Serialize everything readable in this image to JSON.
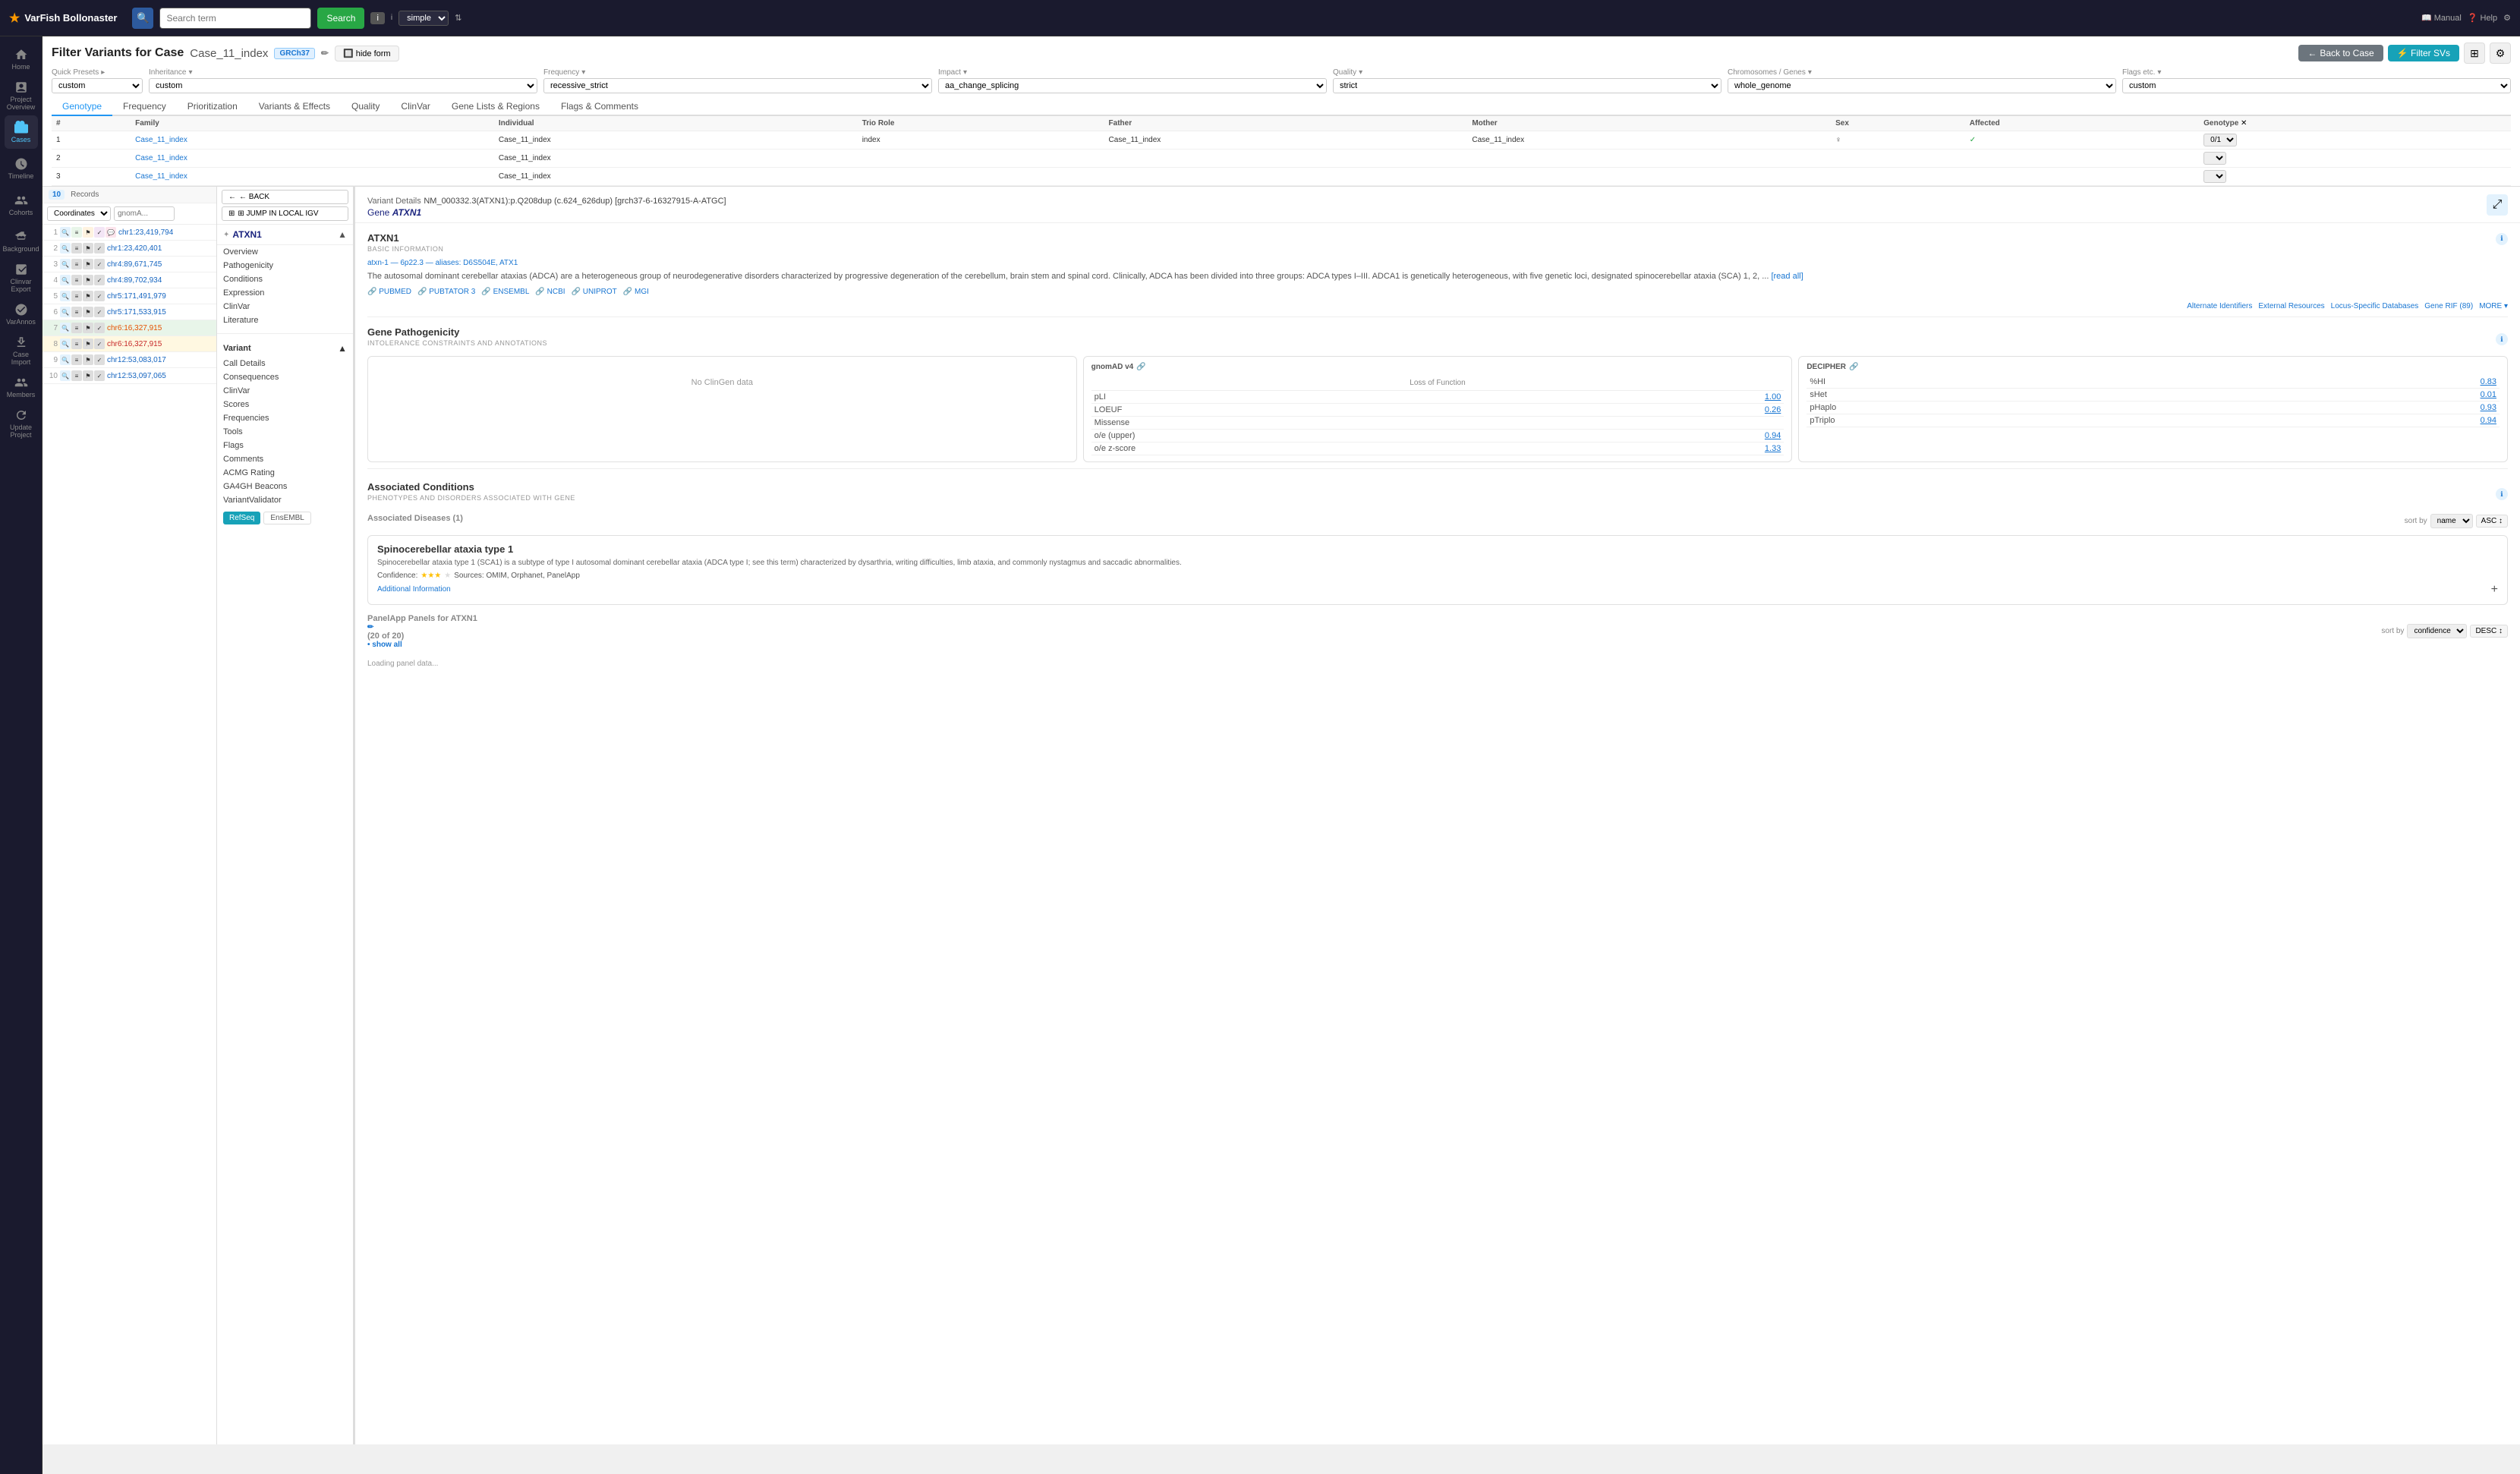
{
  "app": {
    "name": "VarFish",
    "name_colored": "Bollonaster",
    "logo": "★"
  },
  "navbar": {
    "search_placeholder": "Search term",
    "search_btn": "Search",
    "toggle_label": "i",
    "mode_label": "simple",
    "manual_label": "Manual",
    "help_label": "Help"
  },
  "header": {
    "title": "Filter Variants for Case",
    "case_name": "Case_11_index",
    "grch_badge": "GRCh37",
    "hide_form": "hide form",
    "back_to_case": "Back to Case",
    "filter_svs": "Filter SVs"
  },
  "filter_row": {
    "quick_presets_label": "Quick Presets",
    "quick_presets_arrow": "▸",
    "inheritance_label": "Inheritance",
    "inheritance_arrow": "▾",
    "inheritance_value": "custom",
    "frequency_label": "Frequency",
    "frequency_arrow": "▾",
    "frequency_value": "recessive_strict",
    "impact_label": "Impact",
    "impact_arrow": "▾",
    "impact_value": "aa_change_splicing",
    "quality_label": "Quality",
    "quality_arrow": "▾",
    "quality_value": "strict",
    "chromosomes_label": "Chromosomes / Genes",
    "chromosomes_arrow": "▾",
    "chromosomes_value": "whole_genome",
    "flags_label": "Flags etc.",
    "flags_arrow": "▾",
    "flags_value": "custom"
  },
  "sub_tabs": [
    {
      "id": "genotype",
      "label": "Genotype"
    },
    {
      "id": "frequency",
      "label": "Frequency"
    },
    {
      "id": "prioritization",
      "label": "Prioritization"
    },
    {
      "id": "variants_effects",
      "label": "Variants & Effects"
    },
    {
      "id": "quality",
      "label": "Quality"
    },
    {
      "id": "clinvar",
      "label": "ClinVar"
    },
    {
      "id": "gene_lists",
      "label": "Gene Lists & Regions"
    },
    {
      "id": "flags_comments",
      "label": "Flags & Comments"
    }
  ],
  "active_tab": "genotype",
  "genotype_table": {
    "columns": [
      "#",
      "Family",
      "Individual",
      "Trio Role",
      "Father",
      "Mother",
      "Sex",
      "Affected",
      "Genotype"
    ],
    "rows": [
      {
        "num": "1",
        "family": "Case_11_index",
        "individual": "Case_11_index",
        "trio_role": "index",
        "father": "Case_11_index",
        "mother": "Case_11_index",
        "sex": "♀",
        "affected": "✓",
        "genotype": "0/1"
      },
      {
        "num": "2",
        "family": "Case_11_index",
        "individual": "Case_11_index",
        "trio_role": "",
        "father": "",
        "mother": "",
        "sex": "",
        "affected": "",
        "genotype": ""
      },
      {
        "num": "3",
        "family": "Case_11_index",
        "individual": "Case_11_index",
        "trio_role": "",
        "father": "",
        "mother": "",
        "sex": "",
        "affected": "",
        "genotype": ""
      }
    ]
  },
  "ref_seq_btn": "RefSeq",
  "ensembl_btn": "EnsEMBL",
  "gene_name": "ATXN1",
  "gene_sections": {
    "overview": "Overview",
    "pathogenicity": "Pathogenicity",
    "conditions": "Conditions",
    "expression": "Expression",
    "clinvar": "ClinVar",
    "literature": "Literature"
  },
  "variant_subsections": {
    "variant": "Variant",
    "call_details": "Call Details",
    "consequences": "Consequences",
    "clinvar": "ClinVar",
    "scores": "Scores",
    "frequencies": "Frequencies",
    "tools": "Tools",
    "flags": "Flags",
    "comments": "Comments",
    "acmg_rating": "ACMG Rating",
    "ga4gh_beacons": "GA4GH Beacons",
    "variant_validator": "VariantValidator"
  },
  "records": {
    "label": "Records",
    "count": "10",
    "coords_label": "Coordinates",
    "search_placeholder": "gnomA..."
  },
  "variant_rows": [
    {
      "num": 1,
      "coord": "chr1:23,419,794",
      "color": "blue"
    },
    {
      "num": 2,
      "coord": "chr1:23,420,401",
      "color": "blue"
    },
    {
      "num": 3,
      "coord": "chr4:89,671,745",
      "color": "blue"
    },
    {
      "num": 4,
      "coord": "chr4:89,702,934",
      "color": "blue"
    },
    {
      "num": 5,
      "coord": "chr5:171,491,979",
      "color": "blue"
    },
    {
      "num": 6,
      "coord": "chr5:171,533,915",
      "color": "blue"
    },
    {
      "num": 7,
      "coord": "chr6:16,327,915",
      "color": "orange"
    },
    {
      "num": 8,
      "coord": "chr6:16,327,915",
      "color": "red"
    },
    {
      "num": 9,
      "coord": "chr12:53,083,017",
      "color": "blue"
    },
    {
      "num": 10,
      "coord": "chr12:53,097,065",
      "color": "blue"
    }
  ],
  "variant_detail": {
    "title": "Variant Details",
    "variant_id": "NM_000332.3(ATXN1):p.Q208dup (c.624_626dup) [grch37-6-16327915-A-ATGC]",
    "gene_label": "Gene",
    "gene_name": "ATXN1",
    "section_basic": "BASIC INFORMATION",
    "gene_link": "atxn-1 — 6p22.3 — aliases: D6S504E, ATX1",
    "gene_description": "The autosomal dominant cerebellar ataxias (ADCA) are a heterogeneous group of neurodegenerative disorders characterized by progressive degeneration of the cerebellum, brain stem and spinal cord. Clinically, ADCA has been divided into three groups: ADCA types I–III. ADCA1 is genetically heterogeneous, with five genetic loci, designated spinocerebellar ataxia (SCA) 1, 2, ...",
    "read_all": "[read all]",
    "ext_links": [
      "PUBMED",
      "PUBTATOR 3",
      "ENSEMBL",
      "NCBI",
      "UNIPROT",
      "MGI"
    ],
    "alt_ids": "Alternate Identifiers   External Resources   Locus-Specific Databases   Gene RIF (89)   MORE ▾",
    "gene_pathogenicity_title": "Gene Pathogenicity",
    "intolerance_subtitle": "INTOLERANCE CONSTRAINTS AND ANNOTATIONS",
    "no_clinvar": "No ClinGen data",
    "gnomad_title": "gnomAD v4",
    "loss_of_function": "Loss of Function",
    "pli_label": "pLI",
    "pli_value": "1.00",
    "loeuf_label": "LOEUF",
    "loeuf_value": "0.26",
    "missense_label": "Missense",
    "ole_upper_label": "o/e (upper)",
    "ole_upper_value": "0.94",
    "ole_z_label": "o/e z-score",
    "ole_z_value": "1.33",
    "decipher_title": "DECIPHER",
    "phi_label": "%HI",
    "phi_value": "0.83",
    "phet_label": "sHet",
    "phet_value": "0.01",
    "phaplo_label": "pHaplo",
    "phaplo_value": "0.93",
    "ptriplo_label": "pTriplo",
    "ptriplo_value": "0.94",
    "associated_conditions_title": "Associated Conditions",
    "phenotypes_subtitle": "PHENOTYPES AND DISORDERS ASSOCIATED WITH GENE",
    "sort_by_label": "sort by",
    "sort_name": "name",
    "sort_asc": "ASC ↕",
    "associated_diseases_label": "Associated Diseases",
    "associated_diseases_count": "(1)",
    "disease_name": "Spinocerebellar ataxia type 1",
    "disease_desc": "Spinocerebellar ataxia type 1 (SCA1) is a subtype of type I autosomal dominant cerebellar ataxia (ADCA type I; see this term) characterized by dysarthria, writing difficulties, limb ataxia, and commonly nystagmus and saccadic abnormalities.",
    "confidence_label": "Confidence:",
    "confidence_stars": "★★★",
    "sources_label": "Sources: OMIM, Orphanet, PanelApp",
    "additional_info": "Additional Information",
    "panel_app_title": "PanelApp Panels for ATXN1",
    "panel_app_count": "(20 of 20)",
    "show_all": "• show all",
    "sort_confidence": "confidence",
    "sort_desc": "DESC ↕",
    "back_btn": "← BACK",
    "jump_igv_btn": "⊞ JUMP IN LOCAL IGV"
  }
}
